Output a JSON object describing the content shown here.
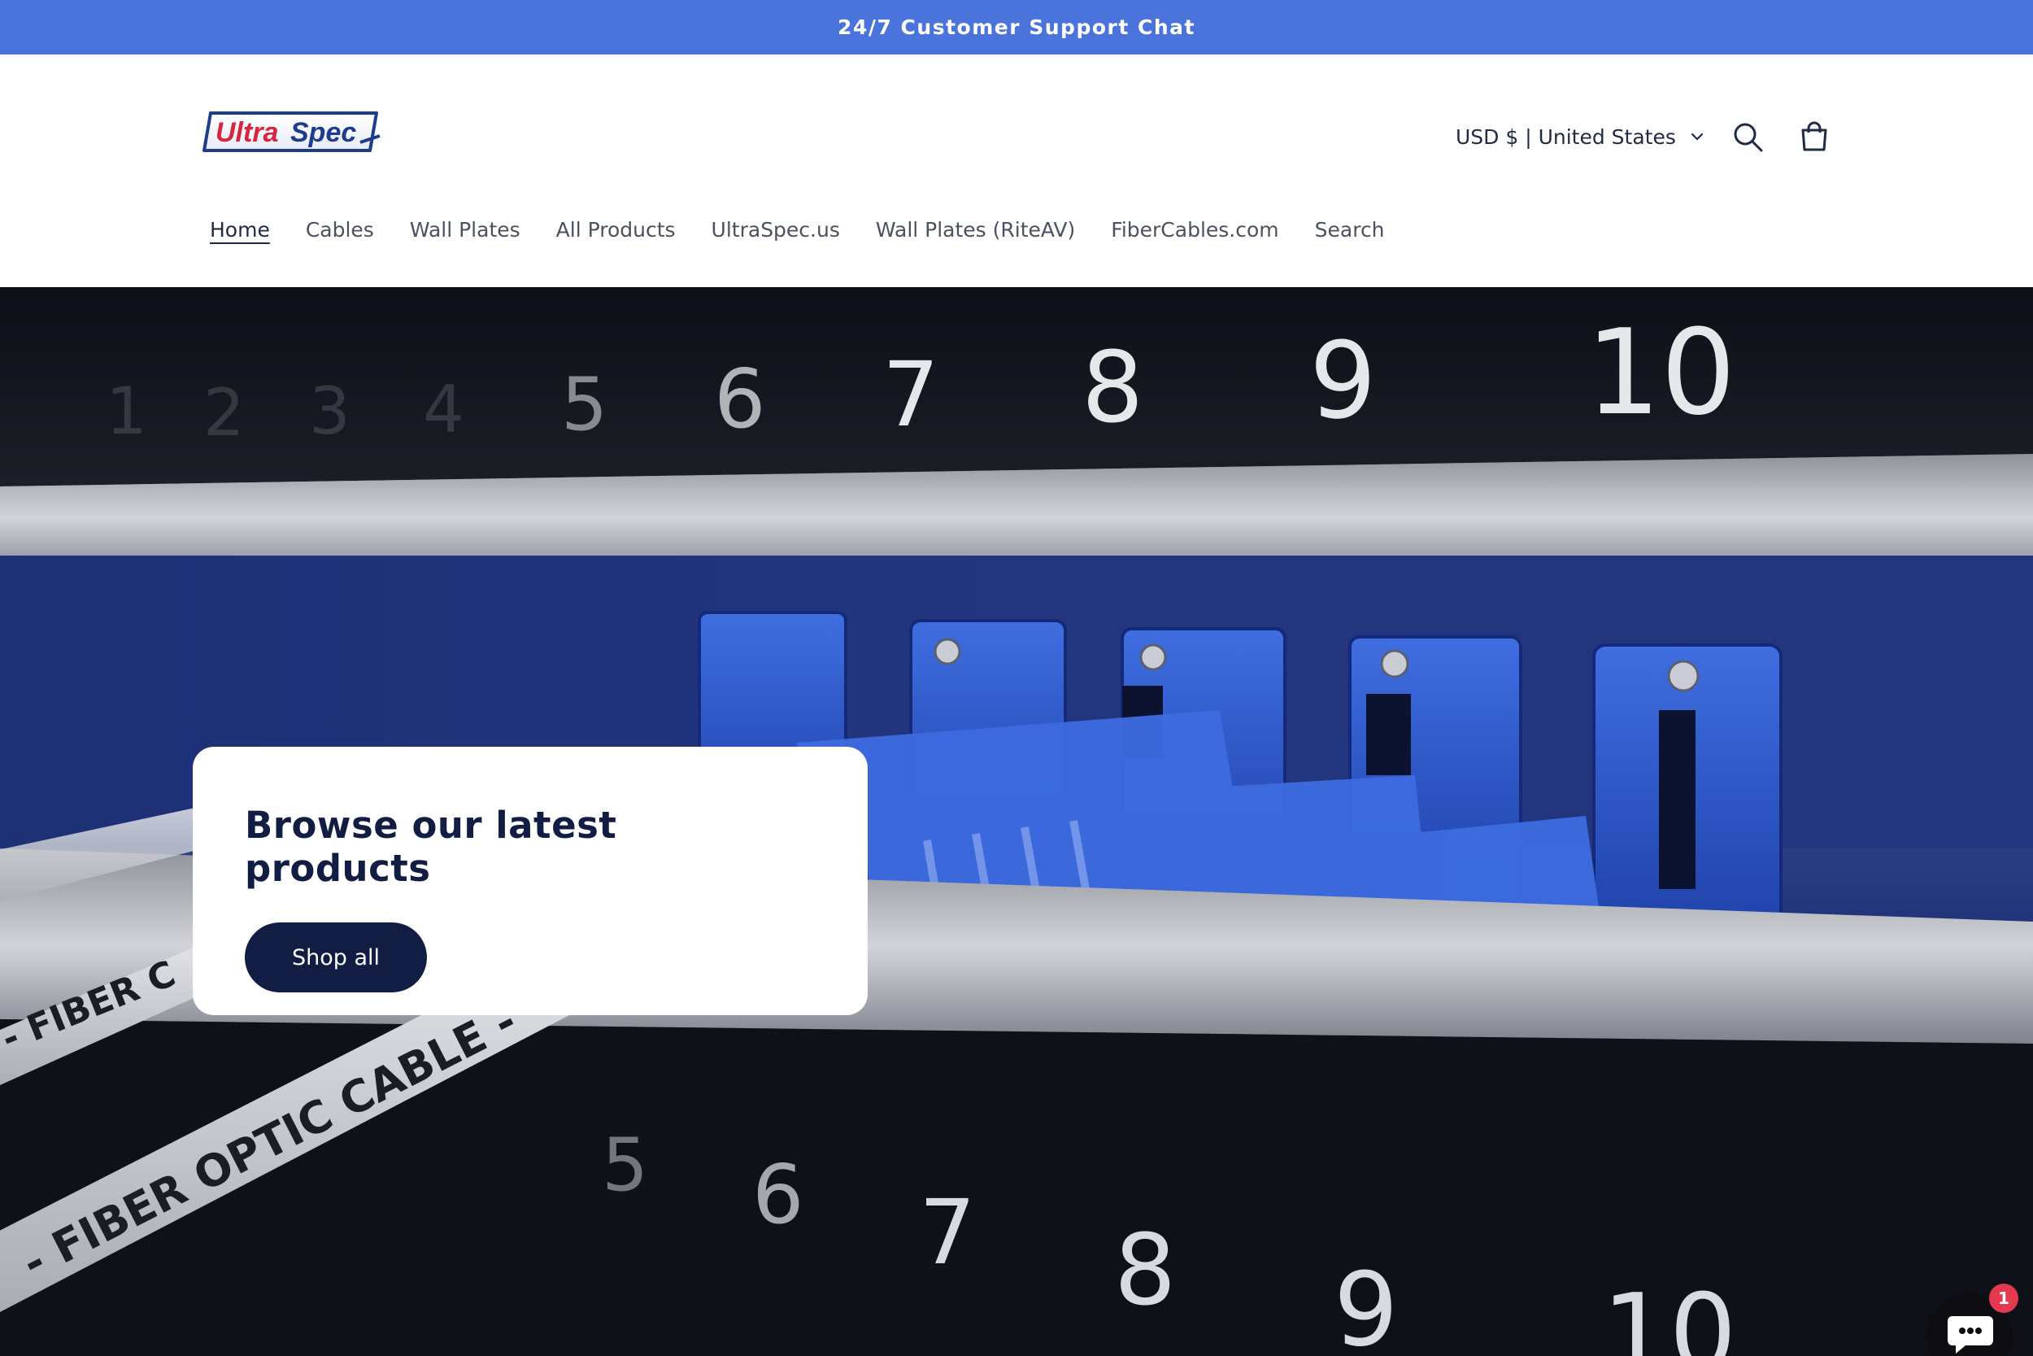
{
  "announcement": {
    "text": "24/7 Customer Support Chat"
  },
  "header": {
    "logo_text": "Ultra Spec",
    "locale_label": "USD $ | United States",
    "icons": {
      "search": "search-icon",
      "cart": "cart-icon",
      "locale_chevron": "chevron-down-icon"
    }
  },
  "nav": {
    "items": [
      {
        "label": "Home",
        "active": true
      },
      {
        "label": "Cables"
      },
      {
        "label": "Wall Plates"
      },
      {
        "label": "All Products"
      },
      {
        "label": "UltraSpec.us"
      },
      {
        "label": "Wall Plates (RiteAV)"
      },
      {
        "label": "FiberCables.com"
      },
      {
        "label": "Search"
      }
    ]
  },
  "hero": {
    "heading": "Browse our latest products",
    "button_label": "Shop all",
    "image_text": {
      "upper_ports": [
        "5",
        "6",
        "7",
        "8",
        "9",
        "10"
      ],
      "lower_ports": [
        "5",
        "6",
        "7",
        "8",
        "9",
        "10"
      ],
      "cable_print_1": "- FIBER OPTIC CABLE -",
      "cable_print_2": "- FIBER C"
    }
  },
  "chat": {
    "badge_count": "1",
    "icon": "chat-bubble-icon"
  },
  "colors": {
    "announcement_bg": "#4a74dc",
    "primary_dark": "#121d44",
    "badge": "#e53950"
  }
}
